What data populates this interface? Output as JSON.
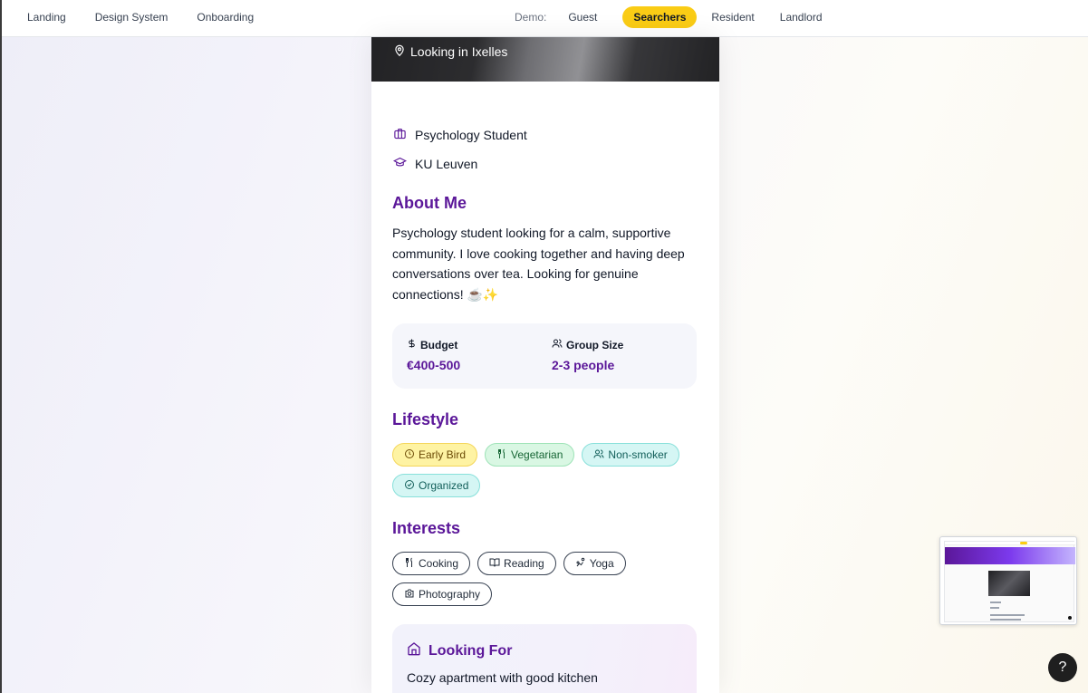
{
  "nav": {
    "links": [
      "Landing",
      "Design System",
      "Onboarding"
    ],
    "demo_label": "Demo:",
    "roles": [
      "Guest",
      "Searchers",
      "Resident",
      "Landlord"
    ],
    "active_role": "Searchers"
  },
  "profile": {
    "location": "Looking in Ixelles",
    "occupation": "Psychology Student",
    "school": "KU Leuven",
    "about_title": "About Me",
    "about_text": "Psychology student looking for a calm, supportive community. I love cooking together and having deep conversations over tea. Looking for genuine connections! ☕✨",
    "budget_label": "Budget",
    "budget_value": "€400-500",
    "group_label": "Group Size",
    "group_value": "2-3 people",
    "lifestyle_title": "Lifestyle",
    "lifestyle": [
      "Early Bird",
      "Vegetarian",
      "Non-smoker",
      "Organized"
    ],
    "interests_title": "Interests",
    "interests": [
      "Cooking",
      "Reading",
      "Yoga",
      "Photography"
    ],
    "looking_for_title": "Looking For",
    "looking_for_text": "Cozy apartment with good kitchen"
  },
  "help": {
    "label": "?"
  },
  "colors": {
    "accent": "#5b1799",
    "active_role_bg": "#facc15"
  }
}
